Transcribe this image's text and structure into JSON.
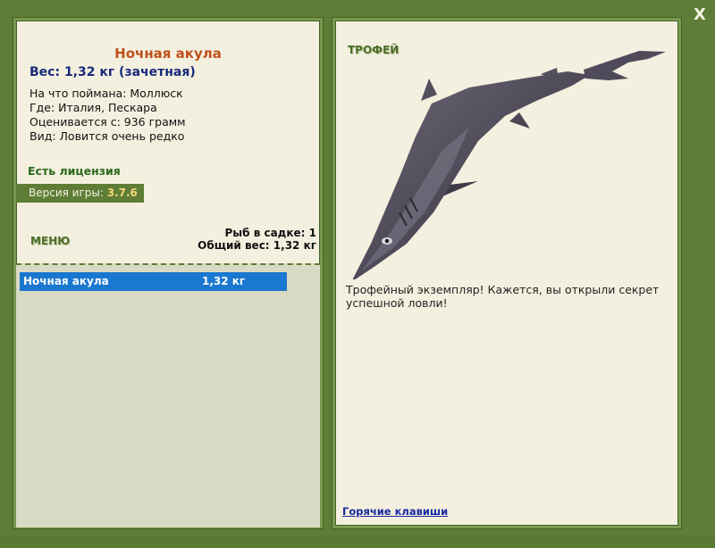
{
  "close_label": "X",
  "fish": {
    "name": "Ночная акула",
    "weight_line": "Вес: 1,32 кг (зачетная)",
    "caught_on": "На что поймана: Моллюск",
    "where": "Где: Италия, Пескара",
    "valued_from": "Оценивается с: 936 грамм",
    "kind": "Вид: Ловится очень редко"
  },
  "license": "Есть лицензия",
  "version": {
    "label": "Версия игры: ",
    "value": "3.7.6"
  },
  "menu_label": "МЕНЮ",
  "summary": {
    "fish_count": "Рыб в садке: 1",
    "total_weight": "Общий вес: 1,32 кг"
  },
  "list": [
    {
      "name": "Ночная акула",
      "weight": "1,32 кг"
    }
  ],
  "trophy": {
    "label": "ТРОФЕЙ",
    "text": "Трофейный экземпляр! Кажется, вы открыли секрет успешной ловли!",
    "hotkeys": "Горячие клавиши"
  },
  "colors": {
    "frame": "#5e7d36",
    "panel": "#f3f0e0",
    "selection": "#1a78d0",
    "fish_name": "#c0501a"
  }
}
